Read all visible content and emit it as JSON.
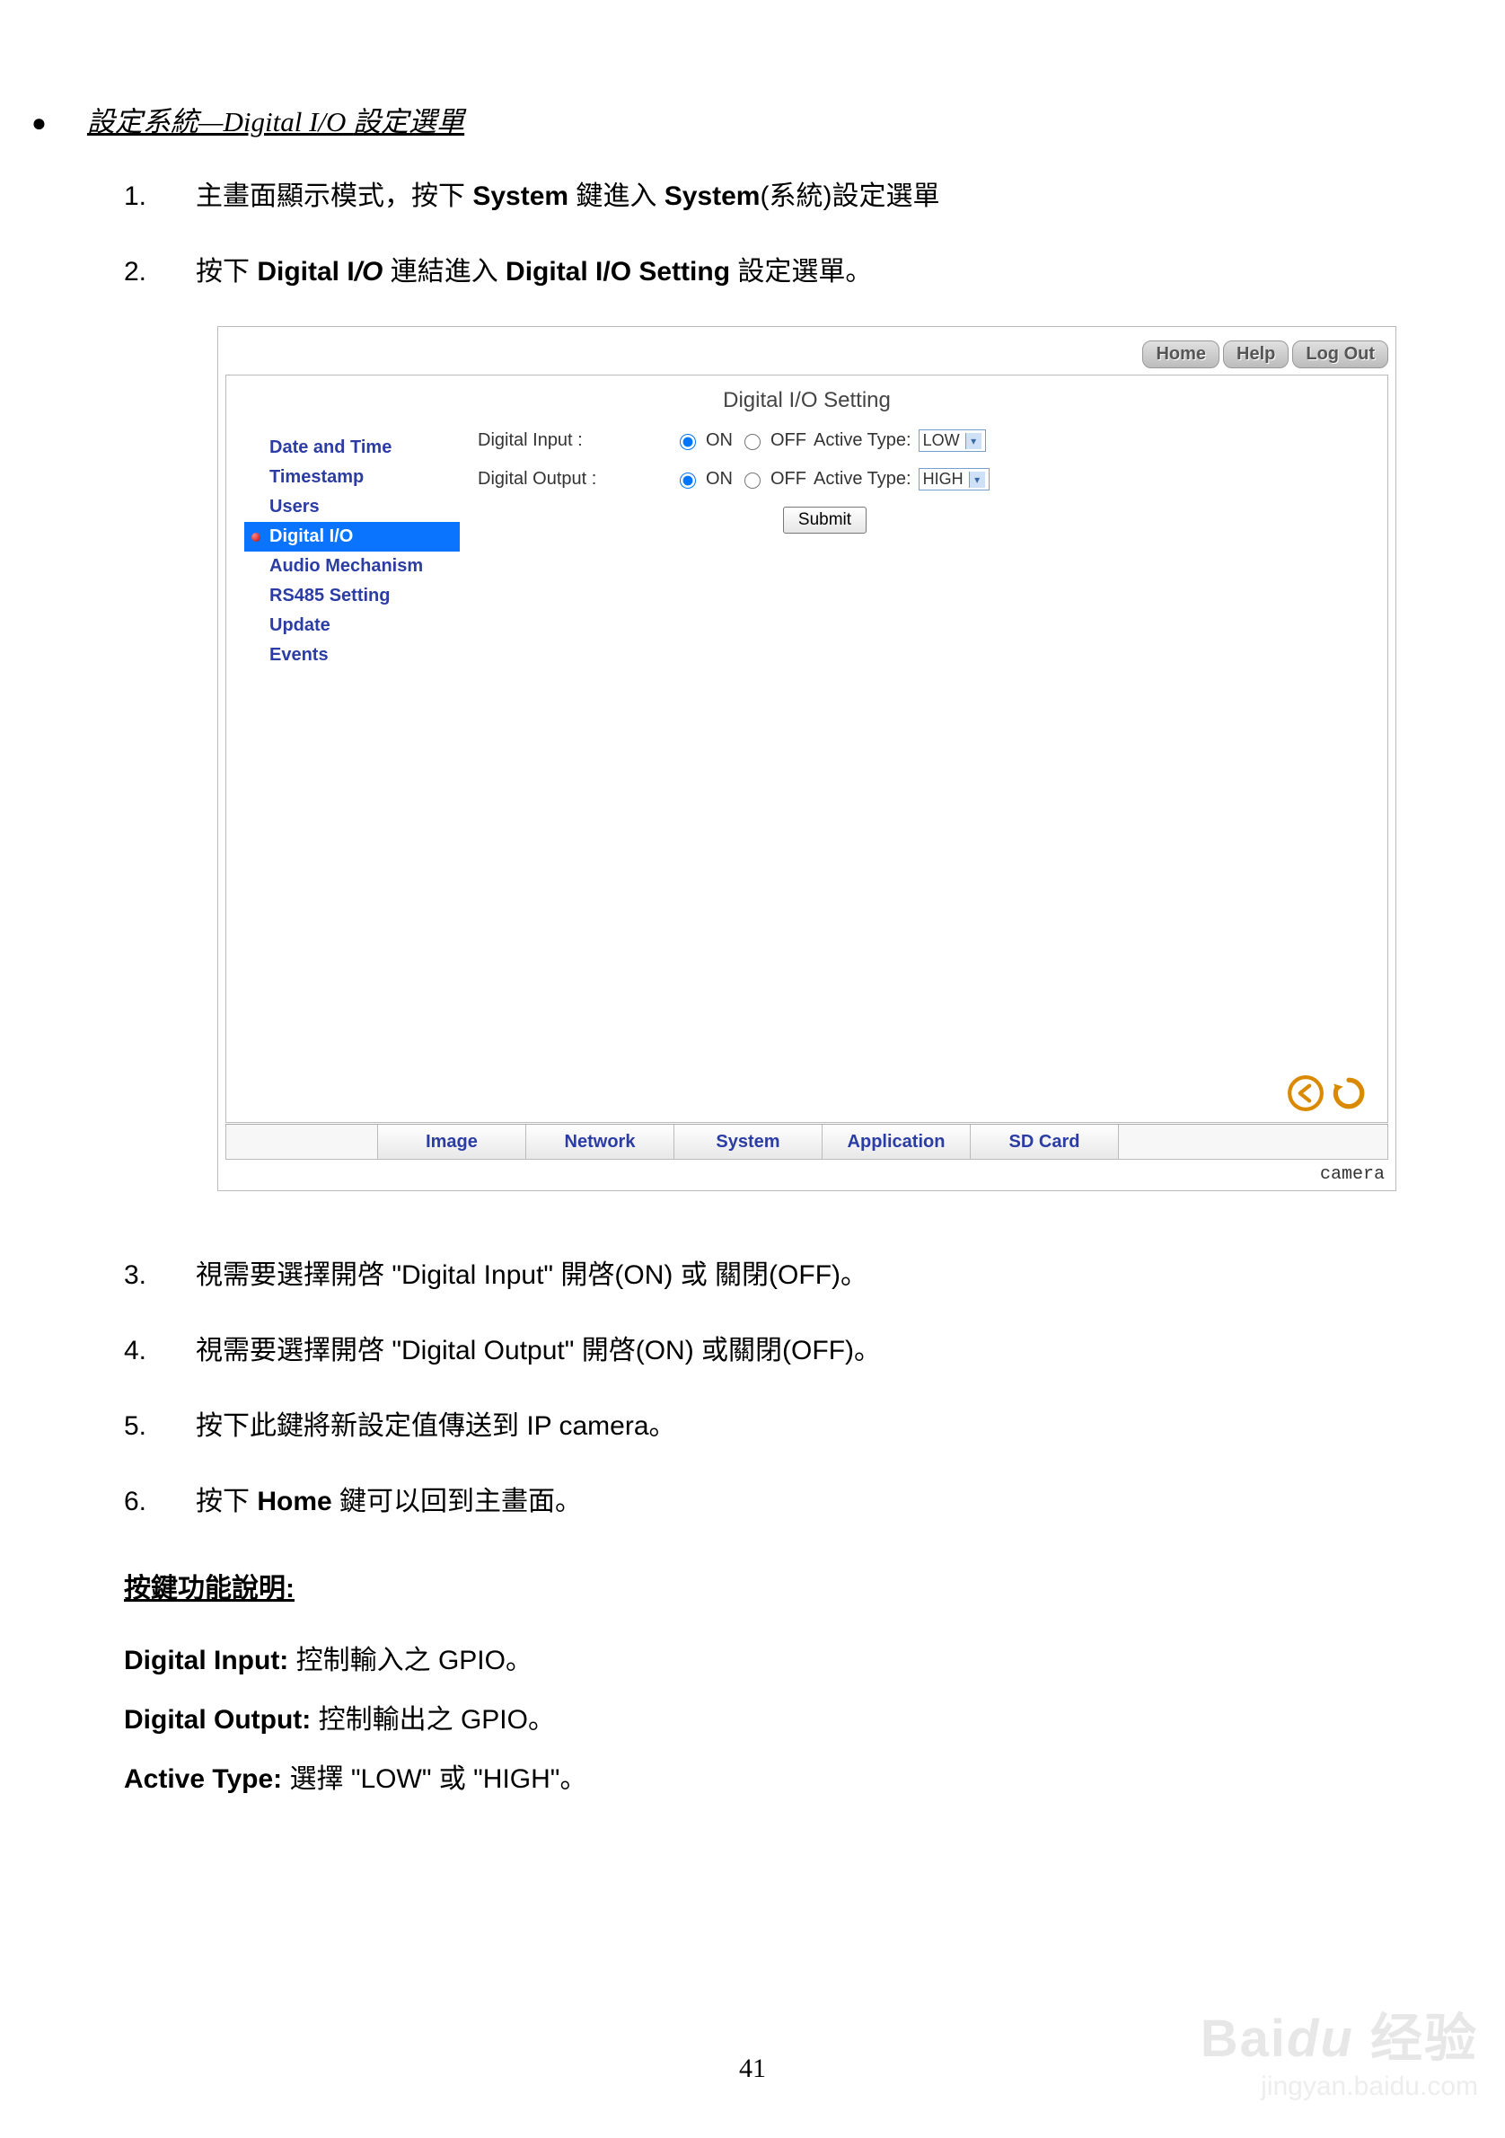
{
  "section_title_prefix": "設定系統—",
  "section_title_mid": "Digital I/O ",
  "section_title_suffix": "設定選單",
  "steps_top": [
    {
      "num": "1.",
      "parts": [
        {
          "t": "主畫面顯示模式，按下 ",
          "b": false
        },
        {
          "t": "System",
          "b": true
        },
        {
          "t": " 鍵進入 ",
          "b": false
        },
        {
          "t": "System",
          "b": true
        },
        {
          "t": "(系統)設定選單",
          "b": false
        }
      ]
    },
    {
      "num": "2.",
      "parts": [
        {
          "t": "按下 ",
          "b": false
        },
        {
          "t": "Digital I",
          "b": true
        },
        {
          "t": "/O",
          "b": true,
          "i": true
        },
        {
          "t": " 連結進入 ",
          "b": false
        },
        {
          "t": "Digital I/O Setting",
          "b": true
        },
        {
          "t": " 設定選單。",
          "b": false
        }
      ]
    }
  ],
  "screenshot": {
    "top_buttons": [
      "Home",
      "Help",
      "Log Out"
    ],
    "panel_title": "Digital I/O Setting",
    "sidebar": [
      {
        "label": "Date and Time",
        "active": false
      },
      {
        "label": "Timestamp",
        "active": false
      },
      {
        "label": "Users",
        "active": false
      },
      {
        "label": "Digital I/O",
        "active": true
      },
      {
        "label": "Audio Mechanism",
        "active": false
      },
      {
        "label": "RS485 Setting",
        "active": false
      },
      {
        "label": "Update",
        "active": false
      },
      {
        "label": "Events",
        "active": false
      }
    ],
    "rows": [
      {
        "label": "Digital Input :",
        "on": "ON",
        "off": "OFF",
        "active_label": "Active Type:",
        "select": "LOW",
        "checked": "on"
      },
      {
        "label": "Digital Output :",
        "on": "ON",
        "off": "OFF",
        "active_label": "Active Type:",
        "select": "HIGH",
        "checked": "on"
      }
    ],
    "submit": "Submit",
    "tabs": [
      "Image",
      "Network",
      "System",
      "Application",
      "SD Card"
    ],
    "camera": "camera"
  },
  "steps_bottom": [
    {
      "num": "3.",
      "text": "視需要選擇開啓 \"Digital Input\" 開啓(ON) 或 關閉(OFF)。"
    },
    {
      "num": "4.",
      "text": "視需要選擇開啓 \"Digital Output\" 開啓(ON) 或關閉(OFF)。"
    },
    {
      "num": "5.",
      "text": "按下此鍵將新設定值傳送到 IP camera。"
    },
    {
      "num": "6.",
      "parts": [
        {
          "t": "按下 ",
          "b": false
        },
        {
          "t": "Home",
          "b": true
        },
        {
          "t": " 鍵可以回到主畫面。",
          "b": false
        }
      ]
    }
  ],
  "desc": {
    "heading": "按鍵功能說明:",
    "items": [
      {
        "label": "Digital Input:",
        "text": " 控制輸入之 GPIO。"
      },
      {
        "label": "Digital Output:",
        "text": " 控制輸出之 GPIO。"
      },
      {
        "label": "Active Type:",
        "text": " 選擇 \"LOW\" 或 \"HIGH\"。"
      }
    ]
  },
  "page_number": "41",
  "watermark_brand_a": "Bai",
  "watermark_brand_b": "du",
  "watermark_brand_c": "经验",
  "watermark_url": "jingyan.baidu.com"
}
